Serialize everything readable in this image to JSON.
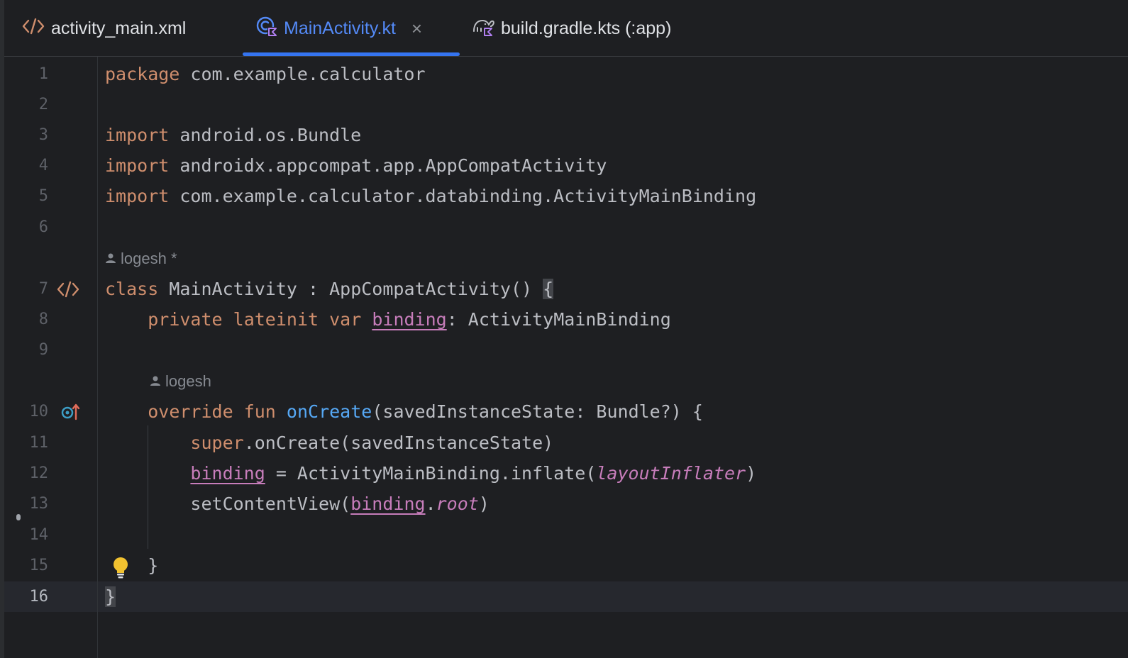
{
  "tabs": [
    {
      "label": "activity_main.xml",
      "icon": "xml-code-icon",
      "active": false
    },
    {
      "label": "MainActivity.kt",
      "icon": "kotlin-class-icon",
      "active": true,
      "close": "×"
    },
    {
      "label": "build.gradle.kts (:app)",
      "icon": "gradle-icon",
      "active": false
    }
  ],
  "editor": {
    "line_numbers": [
      "1",
      "2",
      "3",
      "4",
      "5",
      "6",
      "7",
      "8",
      "9",
      "10",
      "11",
      "12",
      "13",
      "14",
      "15",
      "16"
    ],
    "current_line": "16",
    "inlay_hints": [
      {
        "author": "logesh *",
        "icon": "person-icon"
      },
      {
        "author": "logesh",
        "icon": "person-icon"
      }
    ],
    "code": {
      "l1": {
        "kw": "package",
        "rest": " com.example.calculator"
      },
      "l3": {
        "kw": "import",
        "rest": " android.os.Bundle"
      },
      "l4": {
        "kw": "import",
        "rest": " androidx.appcompat.app.AppCompatActivity"
      },
      "l5": {
        "kw": "import",
        "rest": " com.example.calculator.databinding.ActivityMainBinding"
      },
      "l7": {
        "kw": "class",
        "rest": " MainActivity : AppCompatActivity() ",
        "brace": "{"
      },
      "l8": {
        "kw1": "private",
        "kw2": "lateinit",
        "kw3": "var",
        "prop": "binding",
        "rest": ": ActivityMainBinding"
      },
      "l10": {
        "kw1": "override",
        "kw2": "fun",
        "fn": "onCreate",
        "rest": "(savedInstanceState: Bundle?) {"
      },
      "l11": {
        "kw": "super",
        "rest": ".onCreate(savedInstanceState)"
      },
      "l12": {
        "prop": "binding",
        "mid": " = ActivityMainBinding.inflate(",
        "italic": "layoutInflater",
        "end": ")"
      },
      "l13": {
        "pre": "setContentView(",
        "prop": "binding",
        "dot": ".",
        "italic": "root",
        "end": ")"
      },
      "l15": {
        "text": "}"
      },
      "l16": {
        "brace": "}"
      }
    },
    "gutter_icons": {
      "line7": "xml-layout-icon",
      "line10": "override-method-icon",
      "line15": "lightbulb-icon"
    }
  },
  "colors": {
    "keyword": "#cf8e6d",
    "function": "#56a8f5",
    "property": "#c77dbb",
    "tab_active": "#548af7",
    "tab_underline": "#3574f0",
    "background": "#1e1f22"
  }
}
